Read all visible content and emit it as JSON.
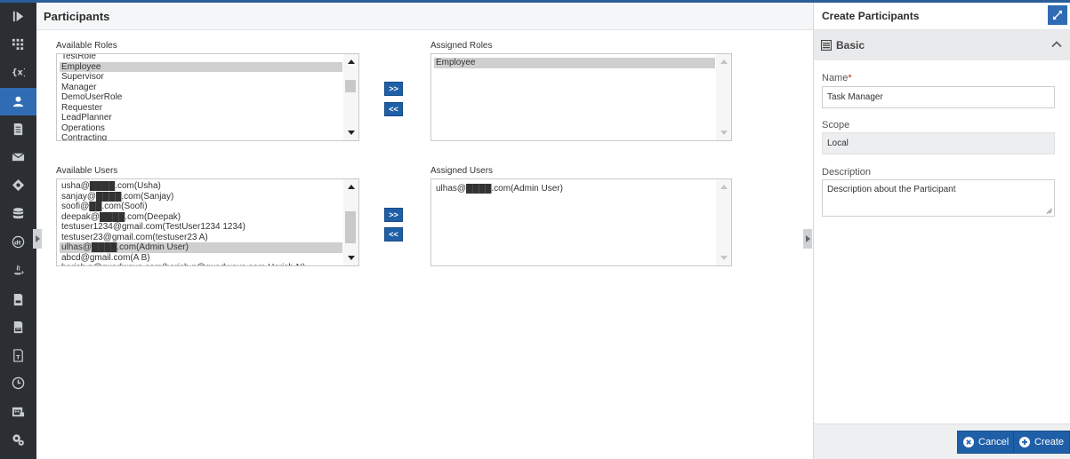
{
  "main": {
    "title": "Participants",
    "available_roles": {
      "label": "Available Roles",
      "options": [
        "TestRole",
        "Employee",
        "Supervisor",
        "Manager",
        "DemoUserRole",
        "Requester",
        "LeadPlanner",
        "Operations",
        "Contracting"
      ],
      "selected": "Employee"
    },
    "assigned_roles": {
      "label": "Assigned Roles",
      "options": [
        "Employee"
      ]
    },
    "available_users": {
      "label": "Available Users",
      "options": [
        "usha@████.com(Usha)",
        "sanjay@████.com(Sanjay)",
        "soofi@██.com(Soofi)",
        "deepak@████.com(Deepak)",
        "testuser1234@gmail.com(TestUser1234 1234)",
        "testuser23@gmail.com(testuser23 A)",
        "ulhas@████.com(Admin User)",
        "abcd@gmail.com(A B)",
        "harish.n@quadwave.com(harish.n@quadwave.com Harish N)"
      ],
      "selected": "ulhas@████.com(Admin User)"
    },
    "assigned_users": {
      "label": "Assigned Users",
      "options": [
        "ulhas@████.com(Admin User)"
      ]
    },
    "add_label": ">>",
    "remove_label": "<<"
  },
  "panel": {
    "title": "Create Participants",
    "section_title": "Basic",
    "name_label": "Name",
    "required_mark": "*",
    "name_value": "Task Manager",
    "scope_label": "Scope",
    "scope_value": "Local",
    "description_label": "Description",
    "description_value": "Description about the Participant",
    "cancel_label": "Cancel",
    "create_label": "Create"
  },
  "icons": {
    "rail": [
      "collapse-icon",
      "dashboard-icon",
      "variables-icon",
      "participants-icon",
      "document-icon",
      "mail-icon",
      "gateway-icon",
      "database-icon",
      "data-type-icon",
      "java-icon",
      "export-icon",
      "css-icon",
      "template-icon",
      "timer-icon",
      "calendar-icon",
      "settings-icon"
    ]
  },
  "colors": {
    "rail_bg": "#2b2f33",
    "accent": "#2f6cb3",
    "button": "#1f5fa8"
  }
}
